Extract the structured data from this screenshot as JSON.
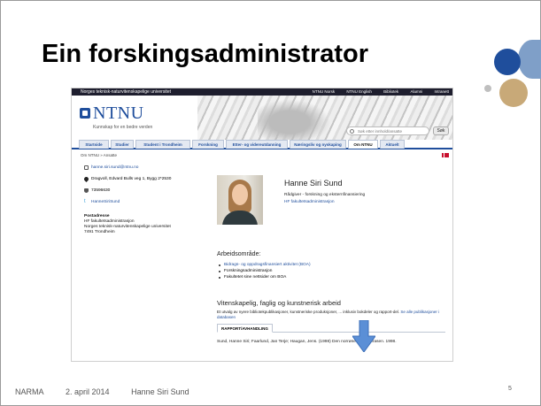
{
  "slide": {
    "title": "Ein forskingsadministrator",
    "footer": {
      "org": "NARMA",
      "date": "2. april 2014",
      "author": "Hanne Siri Sund"
    },
    "page_number": "5",
    "colors": {
      "dark_blue": "#1f4e9c",
      "light_blue": "#7f9fc8",
      "tan": "#c8a978"
    }
  },
  "web": {
    "topbar": {
      "university": "Norges teknisk-naturvitenskapelige universitet",
      "links": [
        "NTNU Norsk",
        "NTNU English",
        "Bibliotek",
        "Alumni",
        "Intranett"
      ]
    },
    "logo": {
      "word": "NTNU",
      "tagline": "Kunnskap for en bedre verden"
    },
    "search": {
      "placeholder": "Søk etter innhold/ansatte",
      "button": "Søk"
    },
    "nav": [
      "Startside",
      "Studier",
      "Student i Trondheim",
      "Forskning",
      "Etter- og videreutdanning",
      "Næringsliv og nyskaping",
      "Om NTNU",
      "Aktuelt"
    ],
    "active_tab": "Om NTNU",
    "breadcrumb": "Om NTNU » Ansatte",
    "contact": {
      "email": "hanne.siri.sund@ntnu.no",
      "address": "Dragvoll, Edvard Bulls veg 1, Bygg 2*2530",
      "phone": "73596630",
      "twitter": "HanneSiriSund"
    },
    "postal": {
      "heading": "Postadresse",
      "lines": [
        "HF fakultetsadministrasjon",
        "Norges teknisk-naturvitenskapelige universitet",
        "7491 Trondheim"
      ]
    },
    "person": {
      "name": "Hanne Siri Sund",
      "role": "Rådgiver - forskning og eksternfinansiering",
      "unit": "HF fakultetsadministrasjon"
    },
    "work_area": {
      "heading": "Arbeidsområde:",
      "items": [
        "Bidrags- og oppdragsfinansiert aktivitet (BOA)",
        "Forskningsadministrasjon",
        "Fakultetet sine nettsider om BOA"
      ]
    },
    "research": {
      "heading": "Vitenskapelig, faglig og kunstnerisk arbeid",
      "intro": "Et utvalg av nyere bibliotekpublikasjoner, kunstneriske produksjoner, ... inklusiv bokdeler og rapport-del.",
      "link": "Se alle publikasjoner i databasen",
      "tab": "RAPPORT/AVHANDLING",
      "citation": "Sund, Hanne Siri; Faarlund, Jan Terje; Haugan, Jens. (1998) Den norrøne normenfrasen. 1998."
    }
  }
}
